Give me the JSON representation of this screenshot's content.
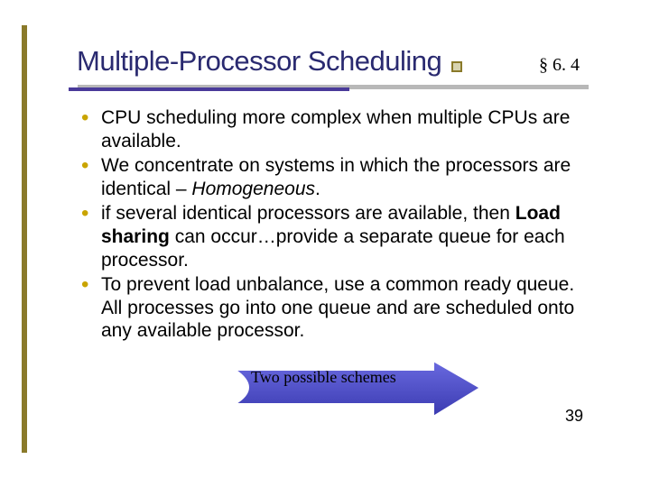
{
  "header": {
    "title": "Multiple-Processor Scheduling",
    "section": "§ 6. 4"
  },
  "bullets": [
    {
      "pre": "CPU scheduling more complex when multiple CPUs are available."
    },
    {
      "pre": "We concentrate on systems in which the processors are identical – ",
      "ital": "Homogeneous",
      "post": "."
    },
    {
      "pre": "if several identical processors are available, then ",
      "bold": "Load sharing",
      "post": " can occur…provide a separate queue for each processor."
    },
    {
      "pre": "To prevent load unbalance, use a common ready queue. All processes go into one queue and are scheduled onto any available processor."
    }
  ],
  "arrow_label": "Two possible schemes",
  "page_number": "39"
}
